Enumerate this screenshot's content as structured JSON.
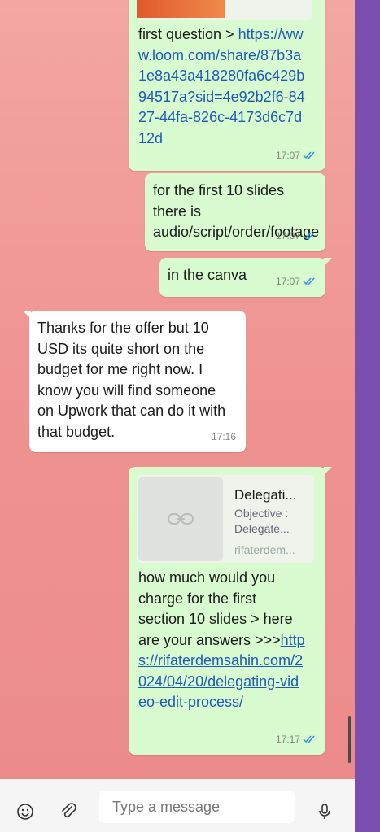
{
  "messages": [
    {
      "id": "m1",
      "dir": "out",
      "time": "17:07",
      "prefix": "first question > ",
      "link": "https://www.loom.com/share/87b3a1e8a43a418280fa6c429b94517a?sid=4e92b2f6-8427-44fa-826c-4173d6c7d12d"
    },
    {
      "id": "m2",
      "dir": "out",
      "time": "17:07",
      "text": "for the first 10 slides there is audio/script/order/footage"
    },
    {
      "id": "m3",
      "dir": "out",
      "time": "17:07",
      "text": "in the canva"
    },
    {
      "id": "m4",
      "dir": "in",
      "time": "17:16",
      "text": "Thanks for the offer but 10 USD its quite short on the budget for me right now. I know you will find someone on Upwork that can do it with that budget."
    },
    {
      "id": "m5",
      "dir": "out",
      "time": "17:17",
      "preview": {
        "title": "Delegati...",
        "description": "Objective : Delegate...",
        "domain": "rifaterdem..."
      },
      "text": "how much would you charge for the first section 10 slides > here are your answers >>>",
      "link": "https://rifaterdemsahin.com/2024/04/20/delegating-video-edit-process/"
    }
  ],
  "composer": {
    "placeholder": "Type a message"
  },
  "icons": {
    "emoji": "emoji-icon",
    "attach": "paperclip-icon",
    "mic": "microphone-icon",
    "read": "double-check-icon",
    "link": "link-icon"
  },
  "colors": {
    "outgoing": "#d8fbd0",
    "incoming": "#ffffff",
    "link": "#1e5bb5",
    "read_ticks": "#3b8fe0",
    "sidebar": "#7a4fb0"
  }
}
